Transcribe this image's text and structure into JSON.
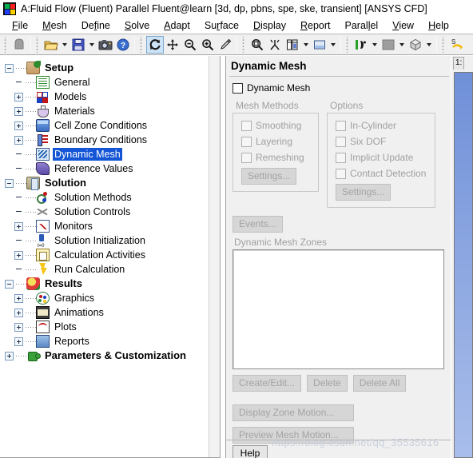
{
  "window": {
    "title": "A:Fluid Flow (Fluent) Parallel Fluent@learn  [3d, dp, pbns, spe, ske, transient] [ANSYS CFD]",
    "app_icon": "fluent-app-icon"
  },
  "menubar": {
    "items": [
      {
        "label": "File",
        "mnemonic": "F"
      },
      {
        "label": "Mesh",
        "mnemonic": "M"
      },
      {
        "label": "Define",
        "mnemonic": "f"
      },
      {
        "label": "Solve",
        "mnemonic": "S"
      },
      {
        "label": "Adapt",
        "mnemonic": "A"
      },
      {
        "label": "Surface",
        "mnemonic": "r"
      },
      {
        "label": "Display",
        "mnemonic": "D"
      },
      {
        "label": "Report",
        "mnemonic": "R"
      },
      {
        "label": "Parallel",
        "mnemonic": "l"
      },
      {
        "label": "View",
        "mnemonic": "V"
      },
      {
        "label": "Help",
        "mnemonic": "H"
      }
    ]
  },
  "toolbar": {
    "groups": [
      {
        "items": [
          {
            "icon": "mouse-probe-icon",
            "label": "Mouse Probe"
          }
        ]
      },
      {
        "items": [
          {
            "icon": "open-folder-icon",
            "label": "Read",
            "dropdown": true
          },
          {
            "icon": "save-disk-icon",
            "label": "Write",
            "dropdown": true
          },
          {
            "icon": "camera-icon",
            "label": "Save Picture"
          },
          {
            "icon": "help-question-icon",
            "label": "Help"
          }
        ]
      },
      {
        "items": [
          {
            "icon": "rotate-refresh-icon",
            "label": "Rotate View",
            "active": true
          },
          {
            "icon": "pan-arrows-icon",
            "label": "Pan"
          },
          {
            "icon": "zoom-out-icon",
            "label": "Zoom Out"
          },
          {
            "icon": "zoom-in-icon",
            "label": "Zoom In"
          },
          {
            "icon": "probe-pointer-icon",
            "label": "Probe"
          }
        ]
      },
      {
        "items": [
          {
            "icon": "zoom-to-fit-icon",
            "label": "Fit to Window"
          },
          {
            "icon": "view-axes-icon",
            "label": "Set Axes"
          },
          {
            "icon": "panel-layout-icon",
            "label": "Layout",
            "dropdown": true
          },
          {
            "icon": "display-window-icon",
            "label": "Display Options",
            "dropdown": true
          }
        ]
      },
      {
        "items": [
          {
            "icon": "lighting-icon",
            "label": "Lights",
            "dropdown": true
          },
          {
            "icon": "color-swatch-icon",
            "label": "Colormap",
            "dropdown": true
          },
          {
            "icon": "render-cube-icon",
            "label": "Rendering",
            "dropdown": true
          }
        ]
      },
      {
        "items": [
          {
            "icon": "sync-arrows-icon",
            "label": "Sync"
          }
        ]
      }
    ]
  },
  "tree": {
    "nodes": [
      {
        "label": "Setup",
        "icon": "setup-icon",
        "level": 0,
        "expander": "minus",
        "bold": true
      },
      {
        "label": "General",
        "icon": "general-icon",
        "level": 1,
        "expander": "none"
      },
      {
        "label": "Models",
        "icon": "models-icon",
        "level": 1,
        "expander": "plus"
      },
      {
        "label": "Materials",
        "icon": "materials-icon",
        "level": 1,
        "expander": "plus"
      },
      {
        "label": "Cell Zone Conditions",
        "icon": "cell-zone-conditions-icon",
        "level": 1,
        "expander": "plus"
      },
      {
        "label": "Boundary Conditions",
        "icon": "boundary-conditions-icon",
        "level": 1,
        "expander": "plus"
      },
      {
        "label": "Dynamic Mesh",
        "icon": "dynamic-mesh-icon",
        "level": 1,
        "expander": "none",
        "selected": true
      },
      {
        "label": "Reference Values",
        "icon": "reference-values-icon",
        "level": 1,
        "expander": "none"
      },
      {
        "label": "Solution",
        "icon": "solution-icon",
        "level": 0,
        "expander": "minus",
        "bold": true
      },
      {
        "label": "Solution Methods",
        "icon": "solution-methods-icon",
        "level": 1,
        "expander": "none"
      },
      {
        "label": "Solution Controls",
        "icon": "solution-controls-icon",
        "level": 1,
        "expander": "none"
      },
      {
        "label": "Monitors",
        "icon": "monitors-icon",
        "level": 1,
        "expander": "plus"
      },
      {
        "label": "Solution Initialization",
        "icon": "solution-initialization-icon",
        "level": 1,
        "expander": "none"
      },
      {
        "label": "Calculation Activities",
        "icon": "calculation-activities-icon",
        "level": 1,
        "expander": "plus"
      },
      {
        "label": "Run Calculation",
        "icon": "run-calculation-icon",
        "level": 1,
        "expander": "none"
      },
      {
        "label": "Results",
        "icon": "results-icon",
        "level": 0,
        "expander": "minus",
        "bold": true
      },
      {
        "label": "Graphics",
        "icon": "graphics-icon",
        "level": 1,
        "expander": "plus"
      },
      {
        "label": "Animations",
        "icon": "animations-icon",
        "level": 1,
        "expander": "plus"
      },
      {
        "label": "Plots",
        "icon": "plots-icon",
        "level": 1,
        "expander": "plus"
      },
      {
        "label": "Reports",
        "icon": "reports-icon",
        "level": 1,
        "expander": "plus"
      },
      {
        "label": "Parameters & Customization",
        "icon": "parameters-customization-icon",
        "level": 0,
        "expander": "plus",
        "bold": true
      }
    ]
  },
  "task_panel": {
    "title": "Dynamic Mesh",
    "enable_checkbox": {
      "label": "Dynamic Mesh",
      "checked": false,
      "enabled": true
    },
    "mesh_methods": {
      "title": "Mesh Methods",
      "items": [
        {
          "label": "Smoothing",
          "checked": false,
          "enabled": false
        },
        {
          "label": "Layering",
          "checked": false,
          "enabled": false
        },
        {
          "label": "Remeshing",
          "checked": false,
          "enabled": false
        }
      ],
      "settings_button": "Settings..."
    },
    "options": {
      "title": "Options",
      "items": [
        {
          "label": "In-Cylinder",
          "checked": false,
          "enabled": false
        },
        {
          "label": "Six DOF",
          "checked": false,
          "enabled": false
        },
        {
          "label": "Implicit Update",
          "checked": false,
          "enabled": false
        },
        {
          "label": "Contact Detection",
          "checked": false,
          "enabled": false
        }
      ],
      "settings_button": "Settings..."
    },
    "events_button": "Events...",
    "zones_label": "Dynamic Mesh Zones",
    "zones_items": [],
    "zone_buttons": [
      "Create/Edit...",
      "Delete",
      "Delete All"
    ],
    "motion_buttons": [
      "Display Zone Motion...",
      "Preview Mesh Motion..."
    ],
    "help_button": "Help"
  },
  "graphics": {
    "tab_label": "1:",
    "background_top": "#6f8fd8",
    "background_bottom": "#a8bdea"
  },
  "watermark": {
    "text": "https://blog.csdn.net/qq_35535616"
  },
  "colors": {
    "selection_blue": "#1455d6",
    "toolbar_bg": "#f0f0f0",
    "panel_bg": "#f0f0f0",
    "disabled_text": "#a0a0a0"
  }
}
